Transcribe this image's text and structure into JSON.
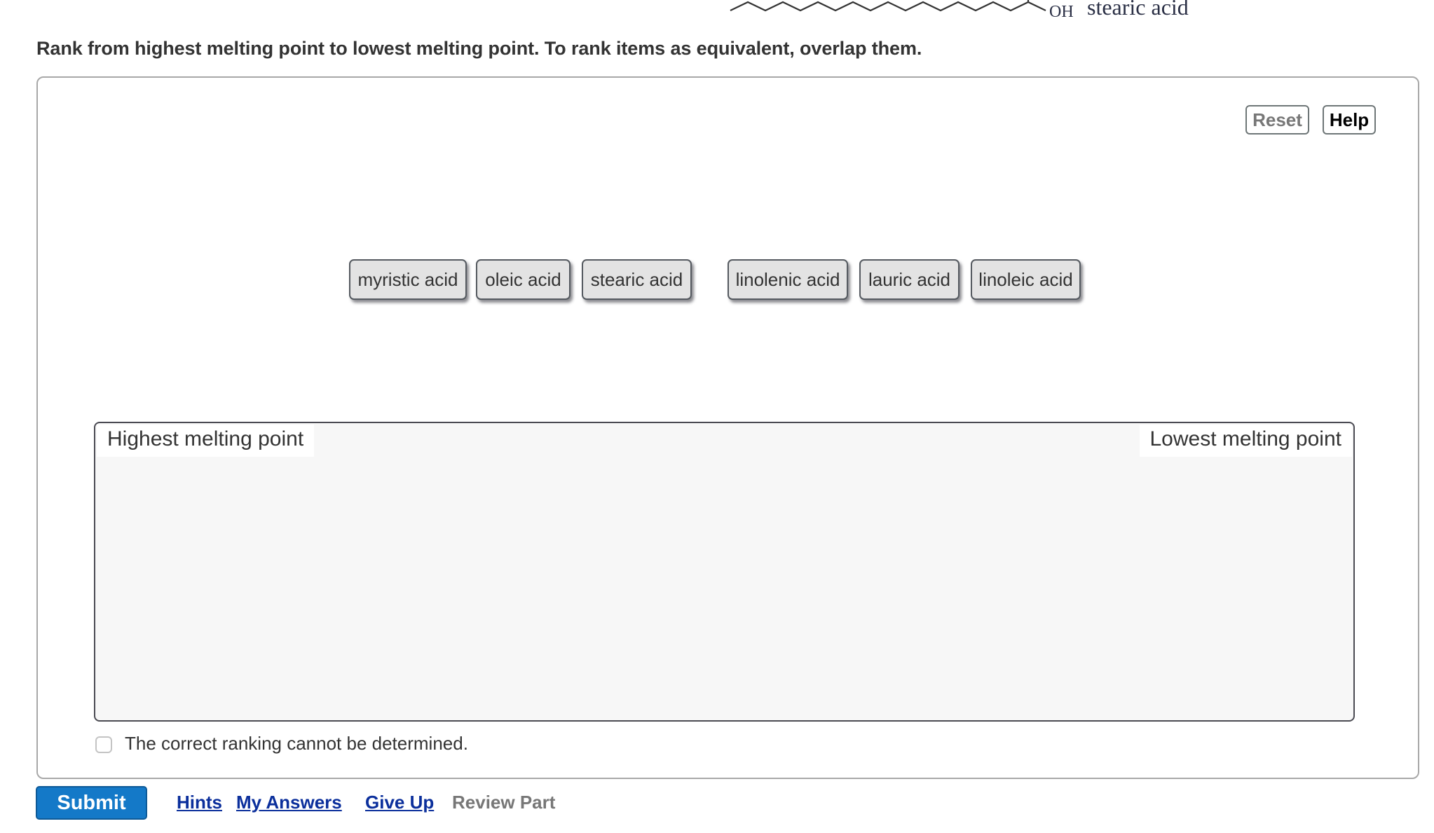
{
  "molecule_caption": {
    "oh_label": "OH",
    "name": "stearic acid"
  },
  "instruction": "Rank from highest melting point to lowest melting point. To rank items as equivalent, overlap them.",
  "toolbar": {
    "reset_label": "Reset",
    "help_label": "Help"
  },
  "items": [
    {
      "label": "myristic acid"
    },
    {
      "label": "oleic acid"
    },
    {
      "label": "stearic acid"
    },
    {
      "label": "linolenic acid"
    },
    {
      "label": "lauric acid"
    },
    {
      "label": "linoleic acid"
    }
  ],
  "ranking": {
    "high_label": "Highest melting point",
    "low_label": "Lowest melting point",
    "placed_items": []
  },
  "cannot_determine": {
    "label": "The correct ranking cannot be determined.",
    "checked": false
  },
  "footer": {
    "submit_label": "Submit",
    "links": [
      {
        "label": "Hints",
        "enabled": true
      },
      {
        "label": "My Answers",
        "enabled": true
      },
      {
        "label": "Give Up",
        "enabled": true
      },
      {
        "label": "Review Part",
        "enabled": false
      }
    ]
  },
  "colors": {
    "submit_bg": "#1479c8",
    "link": "#0b2f9c",
    "chip_bg": "#e3e3e3",
    "rank_box_bg": "#f7f7f7"
  }
}
